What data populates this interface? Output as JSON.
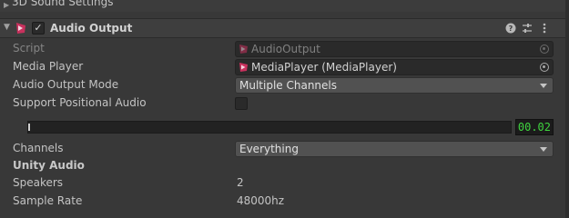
{
  "previous_section": {
    "label": "3D Sound Settings"
  },
  "component": {
    "title": "Audio Output",
    "enabled": true,
    "icons": [
      "help-icon",
      "presets-icon",
      "more-icon"
    ]
  },
  "fields": {
    "script": {
      "label": "Script",
      "value": "AudioOutput"
    },
    "media_player": {
      "label": "Media Player",
      "value": "MediaPlayer (MediaPlayer)"
    },
    "audio_output_mode": {
      "label": "Audio Output Mode",
      "value": "Multiple Channels"
    },
    "support_positional_audio": {
      "label": "Support Positional Audio",
      "checked": false
    },
    "level": {
      "readout": "00.02",
      "fraction": 0.0
    },
    "channels": {
      "label": "Channels",
      "value": "Everything"
    }
  },
  "unity_audio": {
    "heading": "Unity Audio",
    "speakers": {
      "label": "Speakers",
      "value": "2"
    },
    "sample_rate": {
      "label": "Sample Rate",
      "value": "48000hz"
    }
  },
  "colors": {
    "background": "#383838",
    "level_text": "#3fd43f",
    "brand_icon": "#c8315d"
  }
}
